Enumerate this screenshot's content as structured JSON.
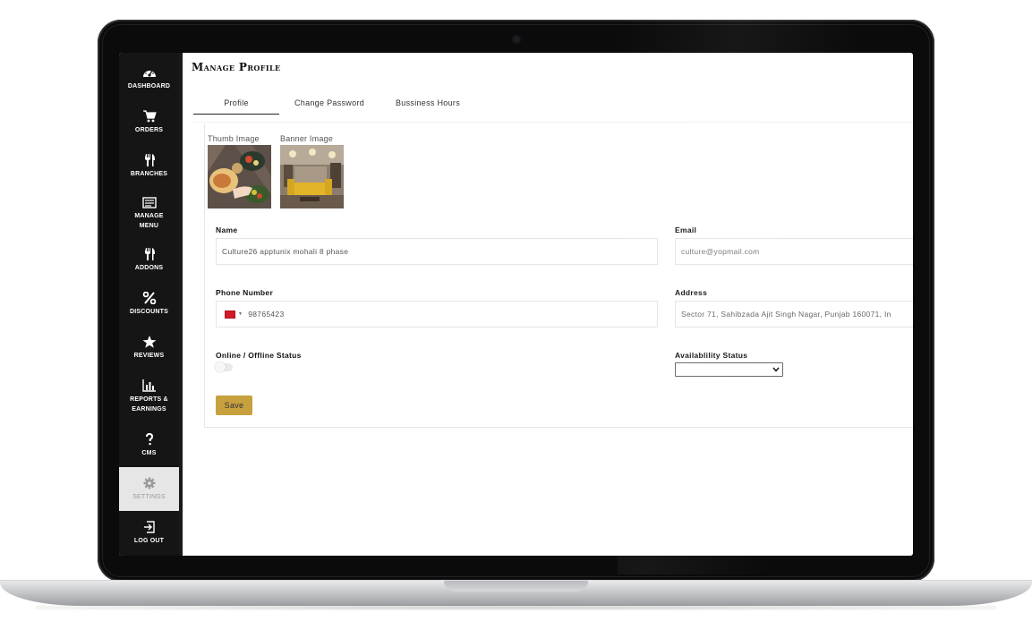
{
  "page": {
    "title": "Manage Profile"
  },
  "sidebar": {
    "items": [
      {
        "label": "Dashboard",
        "icon": "dashboard-icon"
      },
      {
        "label": "Orders",
        "icon": "cart-icon"
      },
      {
        "label": "Branches",
        "icon": "utensils-icon"
      },
      {
        "label": "Manage Menu",
        "icon": "menu-list-icon"
      },
      {
        "label": "Addons",
        "icon": "utensils-icon"
      },
      {
        "label": "Discounts",
        "icon": "percent-icon"
      },
      {
        "label": "Reviews",
        "icon": "star-icon"
      },
      {
        "label": "Reports & Earnings",
        "icon": "bar-chart-icon"
      },
      {
        "label": "CMS",
        "icon": "question-icon"
      },
      {
        "label": "Settings",
        "icon": "gear-icon",
        "active": true
      },
      {
        "label": "Log Out",
        "icon": "logout-icon"
      }
    ]
  },
  "tabs": [
    {
      "label": "Profile",
      "active": true
    },
    {
      "label": "Change Password"
    },
    {
      "label": "Bussiness Hours"
    }
  ],
  "images": {
    "thumb_label": "Thumb Image",
    "banner_label": "Banner Image"
  },
  "form": {
    "name_label": "Name",
    "name_value": "Culture26 apptunix mohali 8 phase",
    "email_label": "Email",
    "email_value": "culture@yopmail.com",
    "phone_label": "Phone Number",
    "phone_value": "98765423",
    "address_label": "Address",
    "address_value": "Sector 71, Sahibzada Ajit Singh Nagar, Punjab 160071, In",
    "status_label": "Online / Offline Status",
    "availability_label": "Availablility Status",
    "availability_value": "",
    "save_label": "Save"
  },
  "colors": {
    "sidebar_bg": "#151515",
    "accent": "#c6a13e",
    "active_nav_bg": "#e6e6e6"
  }
}
